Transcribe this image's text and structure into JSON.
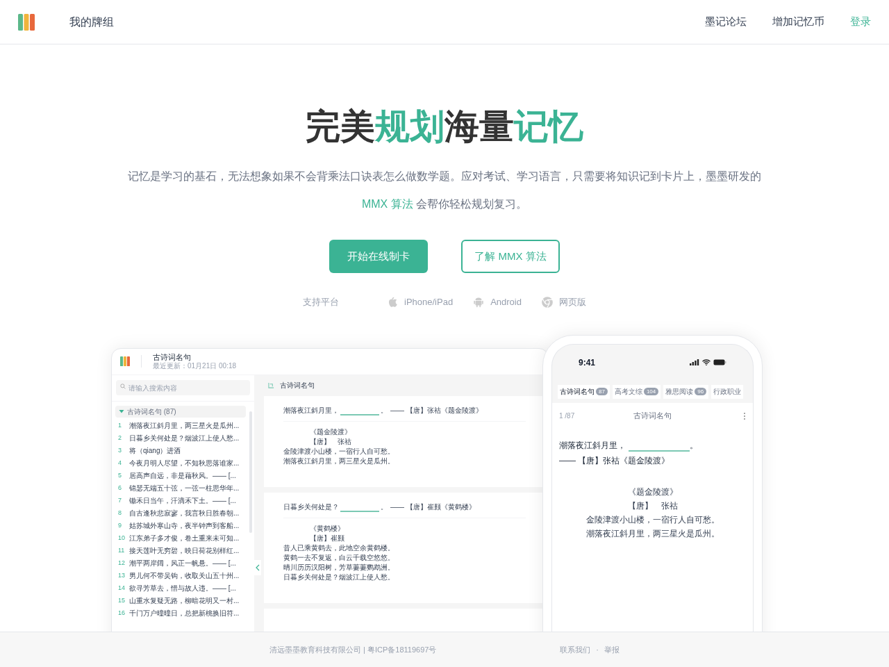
{
  "header": {
    "deck_link": "我的牌组",
    "links": [
      {
        "label": "墨记论坛",
        "highlighted": false
      },
      {
        "label": "增加记忆币",
        "highlighted": false
      },
      {
        "label": "登录",
        "highlighted": true
      }
    ]
  },
  "hero": {
    "title": [
      {
        "text": "完美",
        "accent": false
      },
      {
        "text": "规划",
        "accent": true
      },
      {
        "text": "海量",
        "accent": false
      },
      {
        "text": "记忆",
        "accent": true
      }
    ],
    "description": [
      {
        "text": "记忆是学习的基石，无法想象如果不会背乘法口诀表怎么做数学题。应对考试、学习语言，只需要将知识记到卡片上，墨墨研发的",
        "accent": false
      },
      {
        "text": "MMX 算法",
        "accent": true
      },
      {
        "text": " 会帮你轻松规划复习。",
        "accent": false
      }
    ],
    "buttons": [
      {
        "label": "开始在线制卡",
        "kind": "primary"
      },
      {
        "label": "了解 MMX 算法",
        "kind": "outline"
      }
    ],
    "platforms": {
      "label": "支持平台",
      "items": [
        {
          "label": "iPhone/iPad",
          "kind": "apple"
        },
        {
          "label": "Android",
          "kind": "android"
        },
        {
          "label": "网页版",
          "kind": "web"
        }
      ]
    }
  },
  "desktop_mockup": {
    "deck_title": "古诗词名句",
    "updated": "最近更新：01月21日 00:18",
    "search_placeholder": "请输入搜索内容",
    "list": {
      "title": "古诗词名句 (87)",
      "expanded": true,
      "items": [
        {
          "number": "1",
          "text": "潮落夜江斜月里，两三星火是瓜州..."
        },
        {
          "number": "2",
          "text": "日暮乡关何处是？烟波江上使人愁..."
        },
        {
          "number": "3",
          "text": "将（qiang）进酒"
        },
        {
          "number": "4",
          "text": "今夜月明人尽望，不知秋思落谁家..."
        },
        {
          "number": "5",
          "text": "居高声自远，非是藉秋风。—— [..."
        },
        {
          "number": "6",
          "text": "锦瑟无端五十弦，一弦一柱思华年..."
        },
        {
          "number": "7",
          "text": "锄禾日当午，汗滴禾下土。—— [..."
        },
        {
          "number": "8",
          "text": "自古逢秋悲寂寥，我言秋日胜春朝..."
        },
        {
          "number": "9",
          "text": "姑苏城外寒山寺，夜半钟声到客船..."
        },
        {
          "number": "10",
          "text": "江东弟子多才俊，卷土重来未可知..."
        },
        {
          "number": "11",
          "text": "接天莲叶无穷碧，映日荷花别样红..."
        },
        {
          "number": "12",
          "text": "潮平两岸阔，风正一帆悬。—— [..."
        },
        {
          "number": "13",
          "text": "男儿何不带吴钩，收取关山五十州..."
        },
        {
          "number": "14",
          "text": "欲寻芳草去，惜与故人违。—— [..."
        },
        {
          "number": "15",
          "text": "山重水复疑无路，柳暗花明又一村..."
        },
        {
          "number": "16",
          "text": "千门万户曈曈日，总把新桃换旧符..."
        }
      ]
    },
    "breadcrumb": "古诗词名句",
    "cards": [
      {
        "prompt": "潮落夜江斜月里，",
        "after": "。",
        "source": "—— 【唐】张祜《题金陵渡》",
        "poem_title": "《题金陵渡》",
        "poem_author": "【唐】　张祜",
        "lines": [
          "金陵津渡小山楼，一宿行人自可愁。",
          "潮落夜江斜月里，两三星火是瓜州。"
        ]
      },
      {
        "prompt": "日暮乡关何处是？",
        "after": "。",
        "source": "—— 【唐】崔颢《黄鹤楼》",
        "poem_title": "《黄鹤楼》",
        "poem_author": "【唐】崔颢",
        "lines": [
          "昔人已乘黄鹤去，此地空余黄鹤楼。",
          "黄鹤一去不复返，白云千载空悠悠。",
          "晴川历历汉阳树，芳草萋萋鹦鹉洲。",
          "日暮乡关何处是？烟波江上使人愁。"
        ]
      }
    ]
  },
  "phone_mockup": {
    "time": "9:41",
    "tabs": [
      {
        "label": "古诗词名句",
        "count": "87",
        "selected": true
      },
      {
        "label": "高考文综",
        "count": "104",
        "selected": false
      },
      {
        "label": "雅思阅读",
        "count": "96",
        "selected": false
      },
      {
        "label": "行政职业",
        "selected": false
      }
    ],
    "counter": "1 /87",
    "deck": "古诗词名句",
    "prompt": "潮落夜江斜月里，",
    "after": "。",
    "source": "—— 【唐】张祜《题金陵渡》",
    "poem_title": "《题金陵渡》",
    "poem_author": "【唐】　张祜",
    "lines": [
      "金陵津渡小山楼，一宿行人自可愁。",
      "潮落夜江斜月里，两三星火是瓜州。"
    ]
  },
  "footer": {
    "company": "清远墨墨教育科技有限公司 | 粤ICP备18119697号",
    "links": [
      "联系我们",
      "举报"
    ],
    "separator": "·"
  }
}
